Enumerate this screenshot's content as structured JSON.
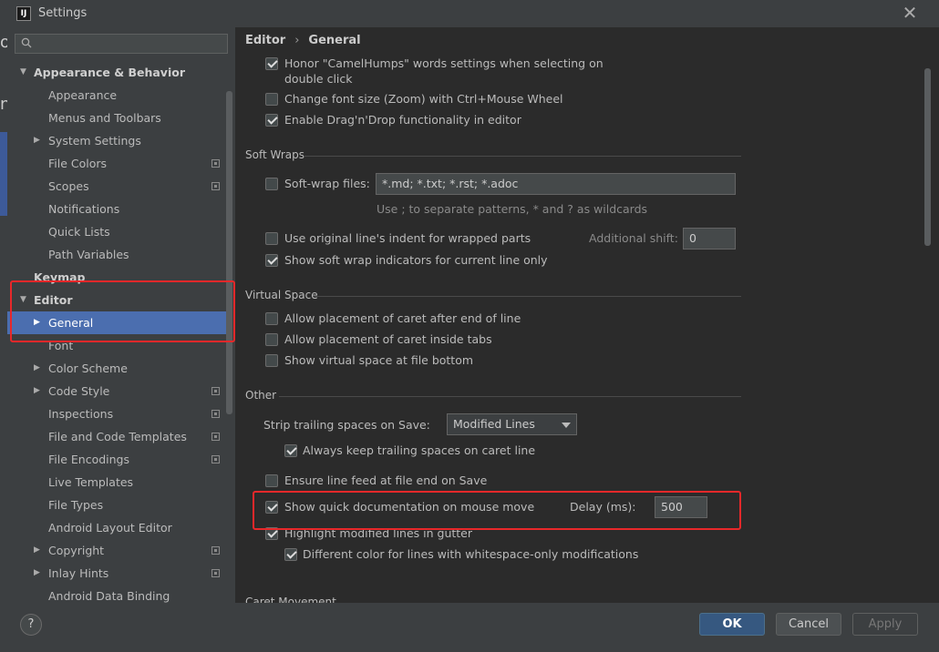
{
  "window": {
    "title": "Settings"
  },
  "background": {
    "glyph_top": "o",
    "glyph_mid": "n"
  },
  "search": {
    "placeholder": ""
  },
  "sidebar": {
    "items": [
      {
        "label": "Appearance & Behavior",
        "level": 0,
        "expanded": true,
        "bold": true
      },
      {
        "label": "Appearance",
        "level": 1
      },
      {
        "label": "Menus and Toolbars",
        "level": 1
      },
      {
        "label": "System Settings",
        "level": 1,
        "collapsed": true
      },
      {
        "label": "File Colors",
        "level": 1,
        "project": true
      },
      {
        "label": "Scopes",
        "level": 1,
        "project": true
      },
      {
        "label": "Notifications",
        "level": 1
      },
      {
        "label": "Quick Lists",
        "level": 1
      },
      {
        "label": "Path Variables",
        "level": 1
      },
      {
        "label": "Keymap",
        "level": 0,
        "bold": true
      },
      {
        "label": "Editor",
        "level": 0,
        "expanded": true,
        "bold": true
      },
      {
        "label": "General",
        "level": 1,
        "collapsed": true,
        "selected": true
      },
      {
        "label": "Font",
        "level": 1
      },
      {
        "label": "Color Scheme",
        "level": 1,
        "collapsed": true
      },
      {
        "label": "Code Style",
        "level": 1,
        "collapsed": true,
        "project": true
      },
      {
        "label": "Inspections",
        "level": 1,
        "project": true
      },
      {
        "label": "File and Code Templates",
        "level": 1,
        "project": true
      },
      {
        "label": "File Encodings",
        "level": 1,
        "project": true
      },
      {
        "label": "Live Templates",
        "level": 1
      },
      {
        "label": "File Types",
        "level": 1
      },
      {
        "label": "Android Layout Editor",
        "level": 1
      },
      {
        "label": "Copyright",
        "level": 1,
        "collapsed": true,
        "project": true
      },
      {
        "label": "Inlay Hints",
        "level": 1,
        "collapsed": true,
        "project": true
      },
      {
        "label": "Android Data Binding",
        "level": 1
      }
    ]
  },
  "breadcrumb": {
    "parent": "Editor",
    "separator": "›",
    "current": "General"
  },
  "content": {
    "camel_line1": "Honor \"CamelHumps\" words settings when selecting on",
    "camel_line2": "double click",
    "camel_checked": true,
    "zoom": "Change font size (Zoom) with Ctrl+Mouse Wheel",
    "zoom_checked": false,
    "dnd": "Enable Drag'n'Drop functionality in editor",
    "dnd_checked": true,
    "soft_wraps": {
      "title": "Soft Wraps",
      "files_label": "Soft-wrap files:",
      "files_checked": false,
      "files_value": "*.md; *.txt; *.rst; *.adoc",
      "hint": "Use ; to separate patterns, * and ? as wildcards",
      "indent": "Use original line's indent for wrapped parts",
      "indent_checked": false,
      "shift_label": "Additional shift:",
      "shift_value": "0",
      "indicators": "Show soft wrap indicators for current line only",
      "indicators_checked": true
    },
    "virtual_space": {
      "title": "Virtual Space",
      "caret_eol": "Allow placement of caret after end of line",
      "caret_tabs": "Allow placement of caret inside tabs",
      "file_bottom": "Show virtual space at file bottom"
    },
    "other": {
      "title": "Other",
      "strip_label": "Strip trailing spaces on Save:",
      "strip_value": "Modified Lines",
      "keep_trailing": "Always keep trailing spaces on caret line",
      "keep_checked": true,
      "line_feed": "Ensure line feed at file end on Save",
      "line_feed_checked": false,
      "quick_doc": "Show quick documentation on mouse move",
      "quick_doc_checked": true,
      "delay_label": "Delay (ms):",
      "delay_value": "500",
      "highlight": "Highlight modified lines in gutter",
      "highlight_checked": true,
      "whitespace": "Different color for lines with whitespace-only modifications",
      "whitespace_checked": true
    },
    "next_section": "Caret Movement"
  },
  "footer": {
    "help": "?",
    "ok": "OK",
    "cancel": "Cancel",
    "apply": "Apply"
  },
  "colors": {
    "selection": "#4b6eaf",
    "highlight_box": "#e8282a",
    "primary_button": "#365880"
  }
}
